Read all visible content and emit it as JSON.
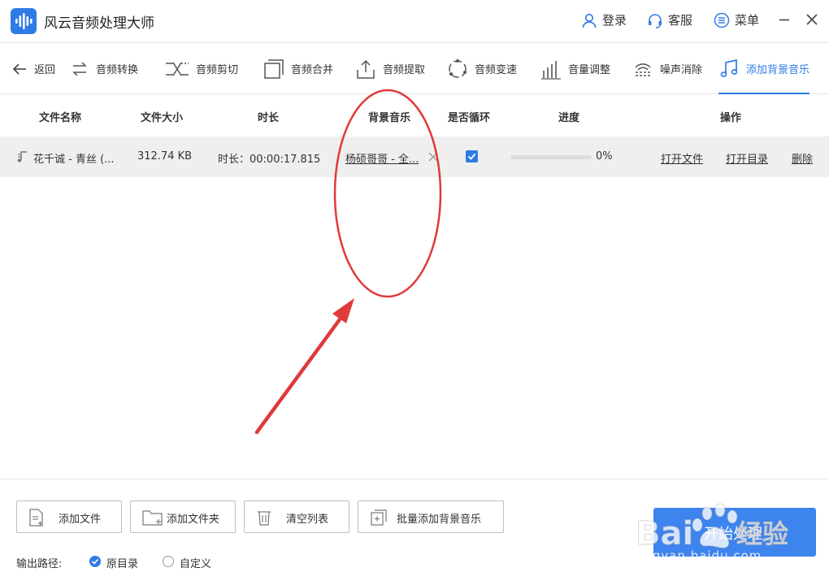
{
  "app": {
    "title": "风云音频处理大师",
    "login": "登录",
    "service": "客服",
    "menu": "菜单"
  },
  "toolbar": {
    "back": "返回",
    "items": [
      {
        "label": "音频转换",
        "icon": "convert-icon"
      },
      {
        "label": "音频剪切",
        "icon": "scissors-icon"
      },
      {
        "label": "音频合并",
        "icon": "merge-icon"
      },
      {
        "label": "音频提取",
        "icon": "extract-icon"
      },
      {
        "label": "音频变速",
        "icon": "speed-icon"
      },
      {
        "label": "音量调整",
        "icon": "volume-bars-icon"
      },
      {
        "label": "噪声消除",
        "icon": "noise-icon"
      },
      {
        "label": "添加背景音乐",
        "icon": "music-note-icon",
        "active": true
      }
    ]
  },
  "table": {
    "headers": [
      "文件名称",
      "文件大小",
      "时长",
      "背景音乐",
      "是否循环",
      "进度",
      "操作"
    ],
    "rows": [
      {
        "name": "花千诚 - 青丝 (...",
        "size": "312.74 KB",
        "duration": "时长：00:00:17.815",
        "bg_music": "杨硕哥哥 - 全...",
        "loop": true,
        "progress_text": "0%",
        "progress": 0,
        "actions": [
          "打开文件",
          "打开目录",
          "删除"
        ]
      }
    ]
  },
  "bottom": {
    "buttons": [
      "添加文件",
      "添加文件夹",
      "清空列表",
      "批量添加背景音乐"
    ],
    "start": "开始处理",
    "output_label": "输出路径:",
    "options": [
      "原目录",
      "自定义"
    ],
    "selected_option": "原目录"
  },
  "watermark": {
    "brand": "Bai",
    "brand2": "经验",
    "url": "jingyan.baidu.com"
  },
  "colors": {
    "accent": "#2f7be5",
    "annotation": "#e03a3a",
    "row_bg": "#efefef"
  }
}
